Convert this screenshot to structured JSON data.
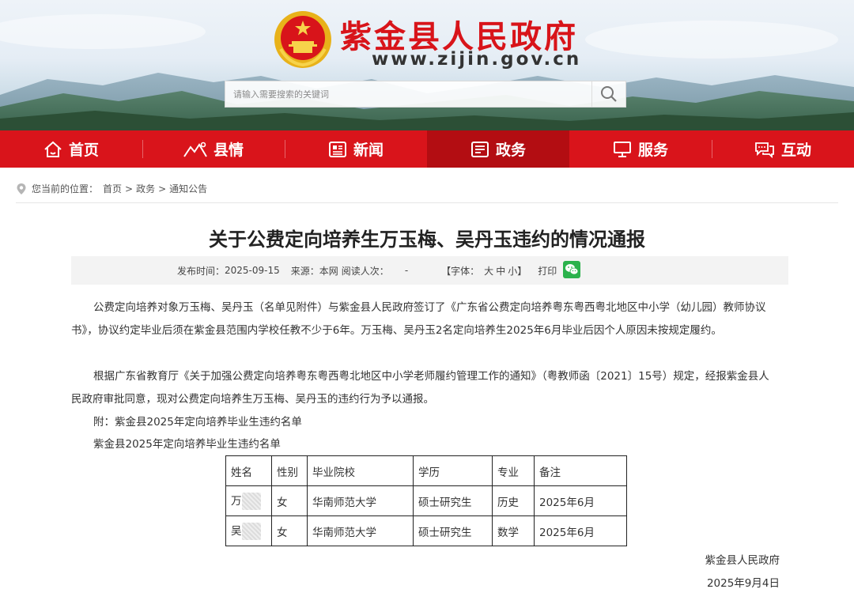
{
  "header": {
    "site_title": "紫金县人民政府",
    "site_url": "www.zijin.gov.cn",
    "search_placeholder": "请输入需要搜索的关键词",
    "brand_color": "#d9141b"
  },
  "nav": {
    "items": [
      {
        "label": "首页",
        "icon": "home-icon"
      },
      {
        "label": "县情",
        "icon": "mountain-icon"
      },
      {
        "label": "新闻",
        "icon": "newspaper-icon"
      },
      {
        "label": "政务",
        "icon": "document-icon",
        "active": true
      },
      {
        "label": "服务",
        "icon": "monitor-icon"
      },
      {
        "label": "互动",
        "icon": "chat-icon"
      }
    ]
  },
  "breadcrumb": {
    "prefix": "您当前的位置：",
    "items": [
      "首页",
      "政务",
      "通知公告"
    ],
    "separator": ">"
  },
  "article": {
    "title": "关于公费定向培养生万玉梅、吴丹玉违约的情况通报",
    "meta": {
      "publish_label": "发布时间：",
      "publish_date": "2025-09-15",
      "source_label": "来源：",
      "source": "本网",
      "views_label": "阅读人次：",
      "views": "-",
      "font_label": "【字体：",
      "font_large": "大",
      "font_medium": "中",
      "font_small": "小",
      "font_close": "】",
      "print_label": "打印"
    },
    "paragraphs": [
      "公费定向培养对象万玉梅、吴丹玉（名单见附件）与紫金县人民政府签订了《广东省公费定向培养粤东粤西粤北地区中小学（幼儿园）教师协议书》，协议约定毕业后须在紫金县范围内学校任教不少于6年。万玉梅、吴丹玉2名定向培养生2025年6月毕业后因个人原因未按规定履约。",
      "根据广东省教育厅《关于加强公费定向培养粤东粤西粤北地区中小学老师履约管理工作的通知》（粤教师函〔2021〕15号）规定，经报紫金县人民政府审批同意，现对公费定向培养生万玉梅、吴丹玉的违约行为予以通报。",
      "附：紫金县2025年定向培养毕业生违约名单",
      "紫金县2025年定向培养毕业生违约名单"
    ],
    "table": {
      "headers": [
        "姓名",
        "性别",
        "毕业院校",
        "学历",
        "专业",
        "备注"
      ],
      "rows": [
        [
          "万",
          "女",
          "华南师范大学",
          "硕士研究生",
          "历史",
          "2025年6月"
        ],
        [
          "吴",
          "女",
          "华南师范大学",
          "硕士研究生",
          "数学",
          "2025年6月"
        ]
      ]
    },
    "signature": "紫金县人民政府",
    "sign_date": "2025年9月4日"
  }
}
